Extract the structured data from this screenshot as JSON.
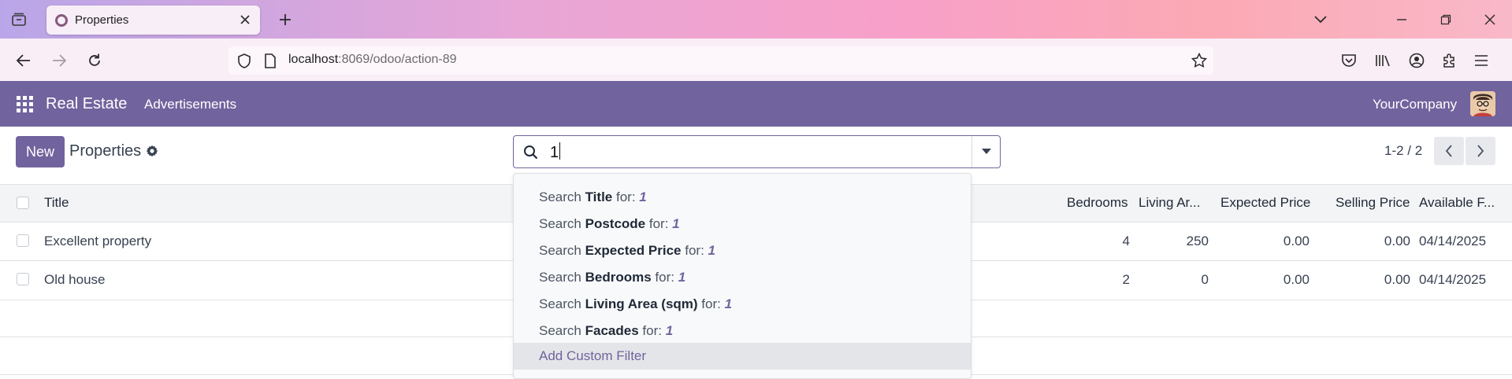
{
  "browser": {
    "tab_title": "Properties",
    "url_host": "localhost",
    "url_path": ":8069/odoo/action-89"
  },
  "app": {
    "brand": "Real Estate",
    "menu": [
      "Advertisements"
    ],
    "company": "YourCompany",
    "accent_color": "#71639e"
  },
  "control_panel": {
    "new_label": "New",
    "title": "Properties",
    "search_value": "1",
    "pager": "1-2 / 2"
  },
  "list": {
    "columns": {
      "title": "Title",
      "bedrooms": "Bedrooms",
      "living_area": "Living Ar...",
      "expected_price": "Expected Price",
      "selling_price": "Selling Price",
      "available_from": "Available F..."
    },
    "rows": [
      {
        "title": "Excellent property",
        "bedrooms": "4",
        "living_area": "250",
        "expected_price": "0.00",
        "selling_price": "0.00",
        "available_from": "04/14/2025"
      },
      {
        "title": "Old house",
        "bedrooms": "2",
        "living_area": "0",
        "expected_price": "0.00",
        "selling_price": "0.00",
        "available_from": "04/14/2025"
      }
    ]
  },
  "autocomplete": {
    "prefix": "Search",
    "for_word": "for:",
    "query": "1",
    "fields": [
      "Title",
      "Postcode",
      "Expected Price",
      "Bedrooms",
      "Living Area (sqm)",
      "Facades"
    ],
    "custom_filter": "Add Custom Filter"
  }
}
